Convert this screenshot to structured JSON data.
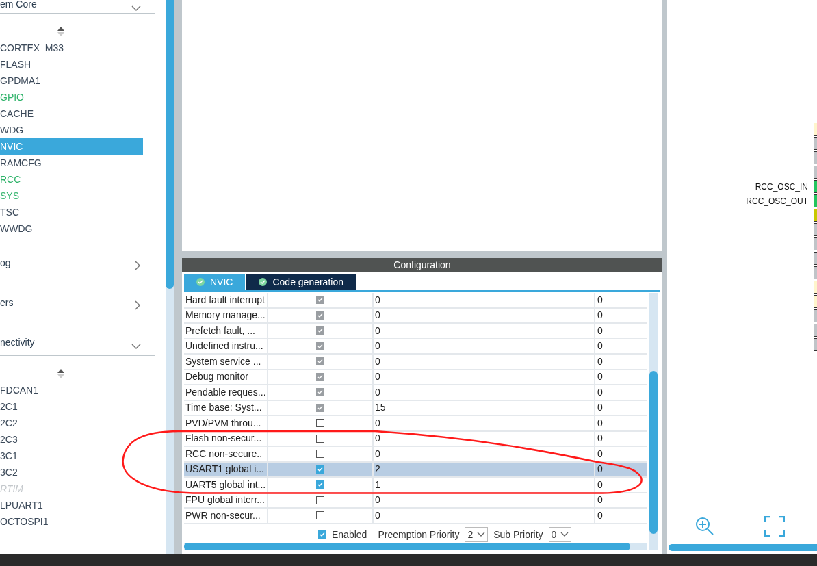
{
  "sidebar": {
    "sections": [
      {
        "title": "em Core",
        "expanded": true,
        "items": [
          {
            "label": "CORTEX_M33",
            "configured": false,
            "disabled": false,
            "selected": false
          },
          {
            "label": "FLASH",
            "configured": false,
            "disabled": false,
            "selected": false
          },
          {
            "label": "GPDMA1",
            "configured": false,
            "disabled": false,
            "selected": false
          },
          {
            "label": "GPIO",
            "configured": true,
            "disabled": false,
            "selected": false
          },
          {
            "label": "CACHE",
            "configured": false,
            "disabled": false,
            "selected": false
          },
          {
            "label": "WDG",
            "configured": false,
            "disabled": false,
            "selected": false
          },
          {
            "label": "NVIC",
            "configured": false,
            "disabled": false,
            "selected": true
          },
          {
            "label": "RAMCFG",
            "configured": false,
            "disabled": false,
            "selected": false
          },
          {
            "label": "RCC",
            "configured": true,
            "disabled": false,
            "selected": false
          },
          {
            "label": "SYS",
            "configured": true,
            "disabled": false,
            "selected": false
          },
          {
            "label": "TSC",
            "configured": false,
            "disabled": false,
            "selected": false
          },
          {
            "label": "WWDG",
            "configured": false,
            "disabled": false,
            "selected": false
          }
        ]
      },
      {
        "title": "og",
        "expanded": false
      },
      {
        "title": "ers",
        "expanded": false
      },
      {
        "title": "nectivity",
        "expanded": true,
        "items": [
          {
            "label": "FDCAN1",
            "configured": false,
            "disabled": false,
            "selected": false
          },
          {
            "label": "2C1",
            "configured": false,
            "disabled": false,
            "selected": false
          },
          {
            "label": "2C2",
            "configured": false,
            "disabled": false,
            "selected": false
          },
          {
            "label": "2C3",
            "configured": false,
            "disabled": false,
            "selected": false
          },
          {
            "label": "3C1",
            "configured": false,
            "disabled": false,
            "selected": false
          },
          {
            "label": "3C2",
            "configured": false,
            "disabled": false,
            "selected": false
          },
          {
            "label": "RTIM",
            "configured": false,
            "disabled": true,
            "selected": false
          },
          {
            "label": "LPUART1",
            "configured": false,
            "disabled": false,
            "selected": false
          },
          {
            "label": "OCTOSPI1",
            "configured": false,
            "disabled": false,
            "selected": false
          }
        ]
      }
    ]
  },
  "configuration": {
    "title": "Configuration",
    "tabs": [
      {
        "label": "NVIC",
        "selected": true
      },
      {
        "label": "Code generation",
        "selected": false
      }
    ],
    "rows": [
      {
        "name": "Hard fault interrupt",
        "checked": true,
        "disabled": true,
        "preemption": "0",
        "sub": "0",
        "selected": false
      },
      {
        "name": "Memory manage...",
        "checked": true,
        "disabled": true,
        "preemption": "0",
        "sub": "0",
        "selected": false
      },
      {
        "name": "Prefetch fault, ...",
        "checked": true,
        "disabled": true,
        "preemption": "0",
        "sub": "0",
        "selected": false
      },
      {
        "name": "Undefined instru...",
        "checked": true,
        "disabled": true,
        "preemption": "0",
        "sub": "0",
        "selected": false
      },
      {
        "name": "System service ...",
        "checked": true,
        "disabled": true,
        "preemption": "0",
        "sub": "0",
        "selected": false
      },
      {
        "name": "Debug monitor",
        "checked": true,
        "disabled": true,
        "preemption": "0",
        "sub": "0",
        "selected": false
      },
      {
        "name": "Pendable reques...",
        "checked": true,
        "disabled": true,
        "preemption": "0",
        "sub": "0",
        "selected": false
      },
      {
        "name": "Time base: Syst...",
        "checked": true,
        "disabled": true,
        "preemption": "15",
        "sub": "0",
        "selected": false
      },
      {
        "name": "PVD/PVM throu...",
        "checked": false,
        "disabled": false,
        "preemption": "0",
        "sub": "0",
        "selected": false
      },
      {
        "name": "Flash non-secur...",
        "checked": false,
        "disabled": false,
        "preemption": "0",
        "sub": "0",
        "selected": false
      },
      {
        "name": "RCC non-secure..",
        "checked": false,
        "disabled": false,
        "preemption": "0",
        "sub": "0",
        "selected": false
      },
      {
        "name": "USART1 global i...",
        "checked": true,
        "disabled": false,
        "preemption": "2",
        "sub": "0",
        "selected": true
      },
      {
        "name": "UART5 global int...",
        "checked": true,
        "disabled": false,
        "preemption": "1",
        "sub": "0",
        "selected": false
      },
      {
        "name": "FPU global interr...",
        "checked": false,
        "disabled": false,
        "preemption": "0",
        "sub": "0",
        "selected": false
      },
      {
        "name": "PWR non-secur...",
        "checked": false,
        "disabled": false,
        "preemption": "0",
        "sub": "0",
        "selected": false
      }
    ],
    "enabled": {
      "label": "Enabled",
      "checked": true
    },
    "preemption": {
      "label": "Preemption Priority",
      "value": "2"
    },
    "sub_priority": {
      "label": "Sub Priority",
      "value": "0"
    }
  },
  "pinout": {
    "pins": [
      {
        "color": "#fff5cc"
      },
      {
        "color": "#c0c4c8"
      },
      {
        "color": "#c0c4c8"
      },
      {
        "color": "#c0c4c8"
      },
      {
        "color": "#22c55e",
        "label": "RCC_OSC_IN"
      },
      {
        "color": "#22c55e",
        "label": "RCC_OSC_OUT"
      },
      {
        "color": "#c8c800"
      },
      {
        "color": "#c0c4c8"
      },
      {
        "color": "#c0c4c8"
      },
      {
        "color": "#c0c4c8"
      },
      {
        "color": "#c0c4c8"
      },
      {
        "color": "#fff5cc"
      },
      {
        "color": "#fff5cc"
      },
      {
        "color": "#c0c4c8"
      },
      {
        "color": "#c0c4c8"
      },
      {
        "color": "#c0c4c8"
      }
    ]
  }
}
